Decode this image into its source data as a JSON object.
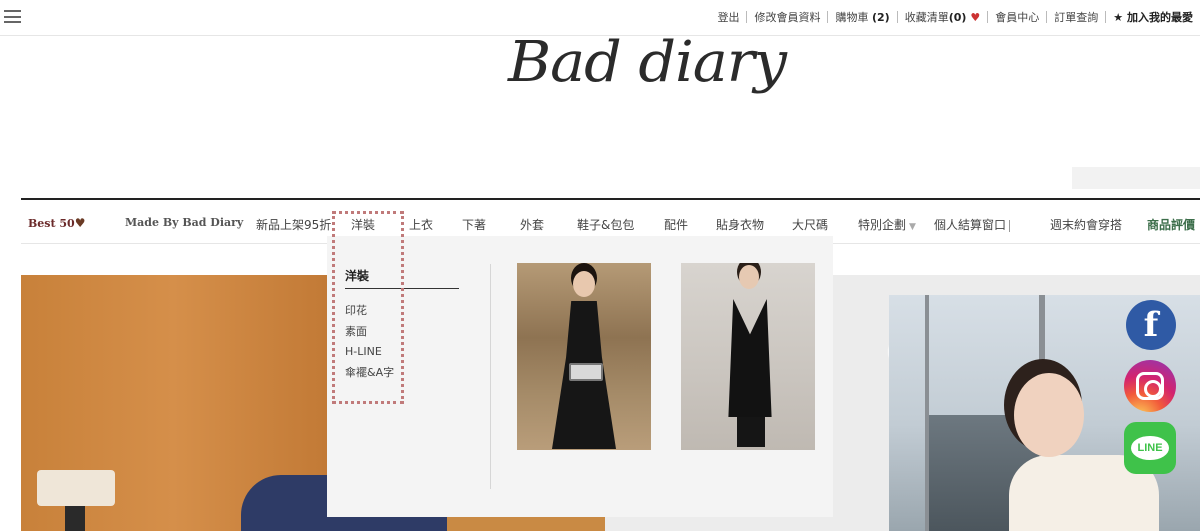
{
  "topbar": {
    "links": [
      "登出",
      "修改會員資料",
      "購物車",
      "收藏清單",
      "會員中心",
      "訂單查詢",
      "★ 加入我的最愛"
    ],
    "cart_count": "(2)",
    "wishlist_count": "(0)"
  },
  "logo": {
    "text": "Bad diary"
  },
  "nav": {
    "best": "Best 50",
    "made_by": "Made By Bad Diary",
    "items": [
      "新品上架95折",
      "洋裝",
      "上衣",
      "下著",
      "外套",
      "鞋子&包包",
      "配件",
      "貼身衣物",
      "大尺碼",
      "特別企劃",
      "個人結算窗口",
      "週末約會穿搭",
      "商品評價"
    ]
  },
  "dropdown": {
    "title": "洋裝",
    "sub_items": [
      "印花",
      "素面",
      "H-LINE",
      "傘襬&A字"
    ]
  },
  "colors": {
    "accent_red": "#c33333",
    "nav_green": "#3c6e4a",
    "highlight_dotted": "#c07a7a"
  },
  "social": {
    "facebook": "f",
    "line": "LINE"
  }
}
